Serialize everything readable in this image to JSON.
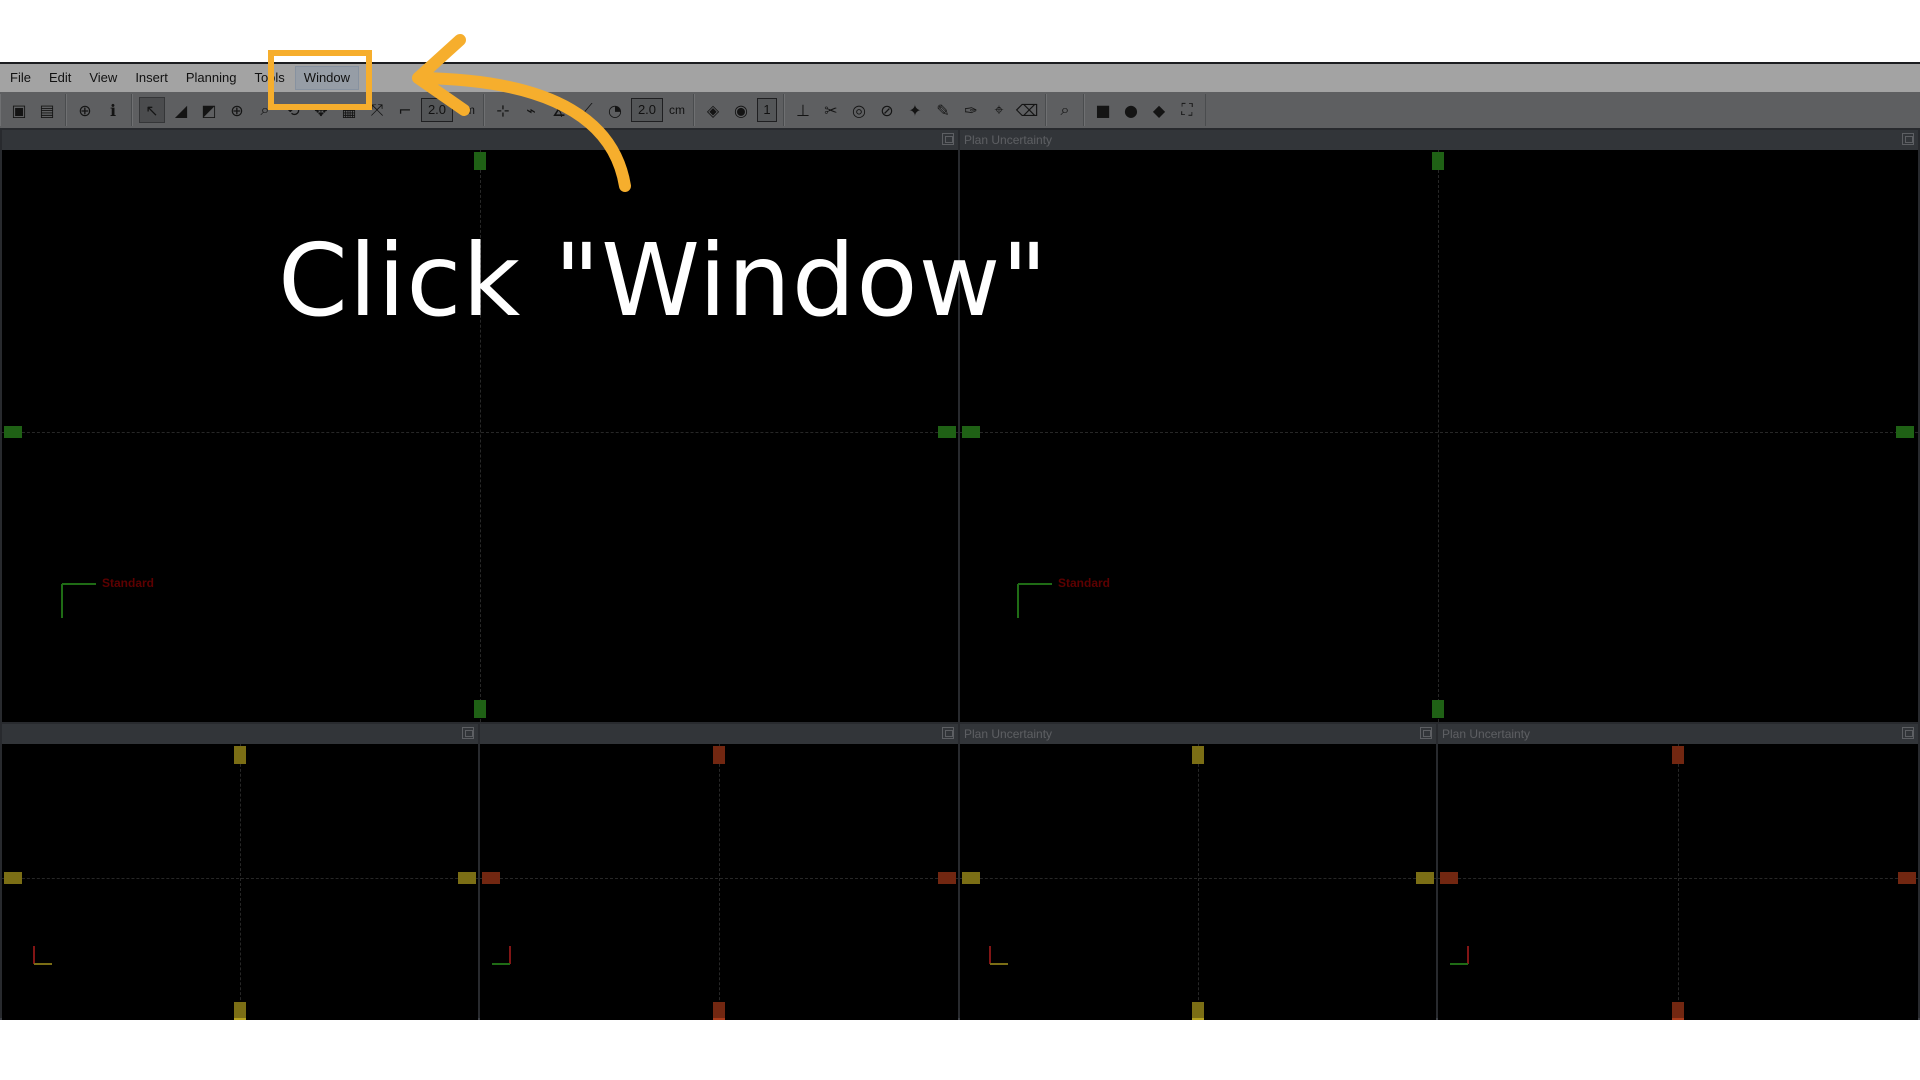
{
  "menu": {
    "items": [
      "File",
      "Edit",
      "View",
      "Insert",
      "Planning",
      "Tools",
      "Window"
    ],
    "active": "Window"
  },
  "toolbar": {
    "field1": "2.0",
    "unit1": "cm",
    "field2": "2.0",
    "unit2": "cm",
    "field3": "1"
  },
  "viewports": {
    "top_left": {
      "title": "",
      "label": "Standard"
    },
    "top_right": {
      "title": "Plan Uncertainty",
      "label": "Standard"
    },
    "bottom_1": {
      "title": ""
    },
    "bottom_2": {
      "title": ""
    },
    "bottom_3": {
      "title": "Plan Uncertainty"
    },
    "bottom_4": {
      "title": "Plan Uncertainty"
    }
  },
  "overlay": {
    "caption": "Click \"Window\"",
    "accent": "#f6ae2d"
  },
  "colors": {
    "marker_green": "#2f8f1f",
    "marker_yellow": "#b5a21f",
    "marker_red": "#a83a1a",
    "label_red": "#8a0000"
  }
}
